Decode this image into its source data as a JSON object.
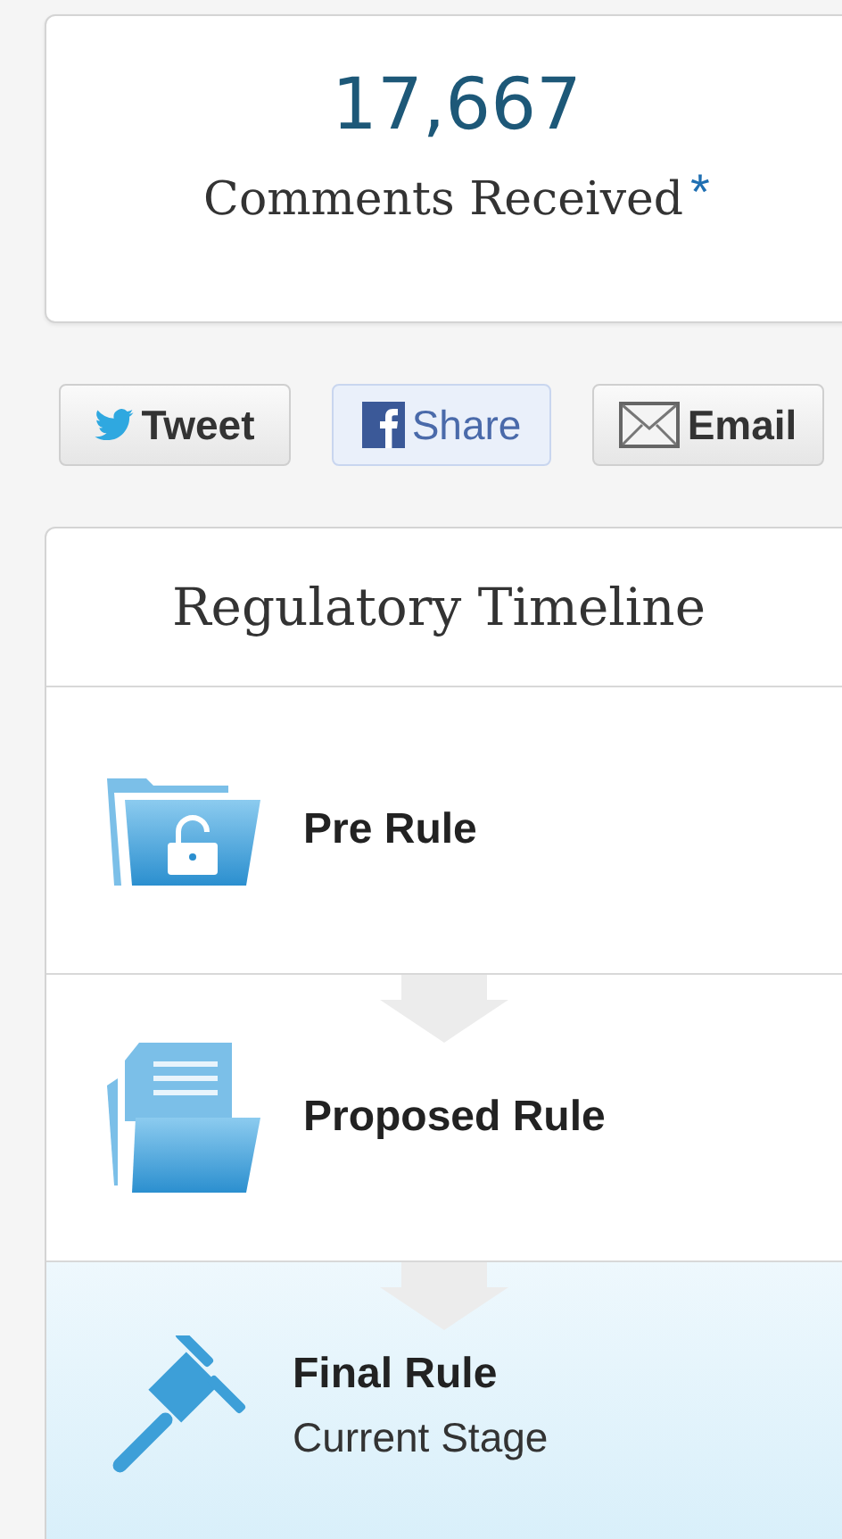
{
  "comments": {
    "count": "17,667",
    "label": "Comments Received",
    "footnote_mark": "*"
  },
  "share_buttons": [
    {
      "kind": "twitter",
      "label": "Tweet",
      "selected": false
    },
    {
      "kind": "facebook",
      "label": "Share",
      "selected": true
    },
    {
      "kind": "email",
      "label": "Email",
      "selected": false
    }
  ],
  "timeline": {
    "title": "Regulatory Timeline",
    "stages": [
      {
        "kind": "open-folder",
        "label": "Pre Rule",
        "current": false
      },
      {
        "kind": "document-folder",
        "label": "Proposed Rule",
        "current": false
      },
      {
        "kind": "gavel",
        "label": "Final Rule",
        "current": true,
        "status": "Current Stage"
      }
    ]
  }
}
